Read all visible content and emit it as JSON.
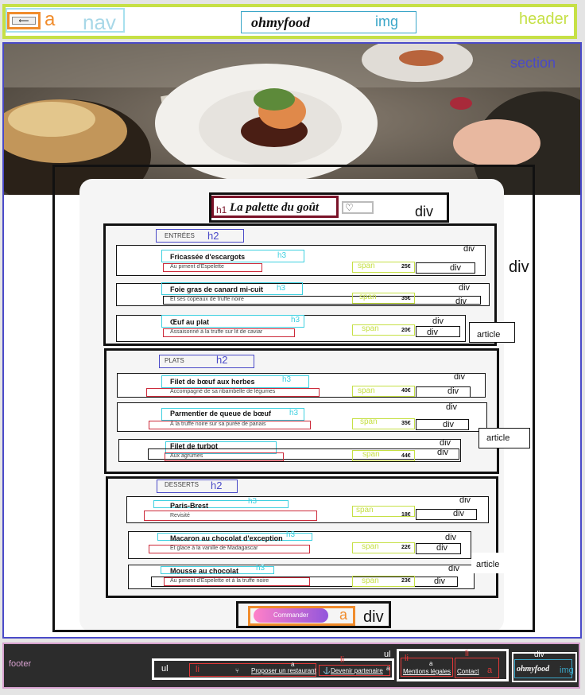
{
  "labels": {
    "header": "header",
    "nav": "nav",
    "a": "a",
    "img": "img",
    "section": "section",
    "div": "div",
    "article": "article",
    "h1": "h1",
    "h2": "h2",
    "h3": "h3",
    "span": "span",
    "footer": "footer",
    "ul": "ul",
    "li": "li"
  },
  "header": {
    "back_icon": "⟵",
    "logo": "ohmyfood"
  },
  "restaurant": {
    "title": "La palette du goût",
    "heart_icon": "♡"
  },
  "menu": {
    "sections": [
      {
        "heading": "ENTRÉES",
        "dishes": [
          {
            "name": "Fricassée d'escargots",
            "desc": "Au piment d'Espelette",
            "price": "25€"
          },
          {
            "name": "Foie gras de canard mi-cuit",
            "desc": "Et ses copeaux de truffe noire",
            "price": "35€"
          },
          {
            "name": "Œuf au plat",
            "desc": "Assaisonné à la truffe sur lit de caviar",
            "price": "20€"
          }
        ]
      },
      {
        "heading": "PLATS",
        "dishes": [
          {
            "name": "Filet de bœuf aux herbes",
            "desc": "Accompagné de sa ribambelle de légumes",
            "price": "40€"
          },
          {
            "name": "Parmentier de queue de bœuf",
            "desc": "À la truffe noire sur sa purée de panais",
            "price": "35€"
          },
          {
            "name": "Filet de turbot",
            "desc": "Aux agrumes",
            "price": "44€"
          }
        ]
      },
      {
        "heading": "DESSERTS",
        "dishes": [
          {
            "name": "Paris-Brest",
            "desc": "Revisité",
            "price": "18€"
          },
          {
            "name": "Macaron au chocolat d'exception",
            "desc": "Et glace à la vanille de Madagascar",
            "price": "22€"
          },
          {
            "name": "Mousse au chocolat",
            "desc": "Au piment d'Espelette et à la truffe noire",
            "price": "23€"
          }
        ]
      }
    ],
    "order_button": "Commander"
  },
  "footer": {
    "links": [
      "Proposer un restaurant",
      "Devenir partenaire",
      "Mentions légales",
      "Contact"
    ],
    "logo": "ohmyfood"
  }
}
